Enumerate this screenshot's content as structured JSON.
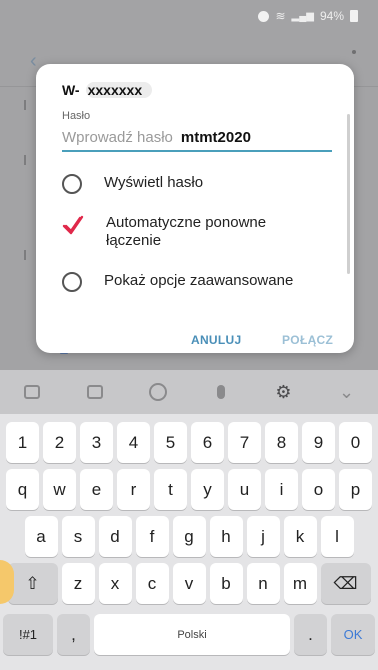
{
  "status": {
    "battery": "94%",
    "icons": [
      "alarm-icon",
      "wifi-icon",
      "signal-icon",
      "battery-icon"
    ]
  },
  "dialog": {
    "ssid_prefix": "W-",
    "ssid_masked": "xxxxxxx",
    "password_label": "Hasło",
    "password_placeholder": "Wprowadź hasło",
    "password_value": "mtmt2020",
    "options": [
      {
        "label": "Wyświetl hasło",
        "checked": false
      },
      {
        "label_line1": "Automatyczne ponowne",
        "label_line2": "łączenie",
        "checked": true
      },
      {
        "label": "Pokaż opcje zaawansowane",
        "checked": false
      }
    ],
    "cancel_label": "ANULUJ",
    "connect_label": "POŁĄCZ"
  },
  "keyboard": {
    "row_numbers": [
      "1",
      "2",
      "3",
      "4",
      "5",
      "6",
      "7",
      "8",
      "9",
      "0"
    ],
    "row1": [
      "q",
      "w",
      "e",
      "r",
      "t",
      "y",
      "u",
      "i",
      "o",
      "p"
    ],
    "row2": [
      "a",
      "s",
      "d",
      "f",
      "g",
      "h",
      "j",
      "k",
      "l"
    ],
    "row3": [
      "z",
      "x",
      "c",
      "v",
      "b",
      "n",
      "m"
    ],
    "symbols_label": "!#1",
    "comma_label": ",",
    "space_label": "Polski",
    "period_label": ".",
    "ok_label": "OK"
  },
  "colors": {
    "accent": "#4a9fbb",
    "check": "#e0284a",
    "ok": "#3c7ad6"
  }
}
